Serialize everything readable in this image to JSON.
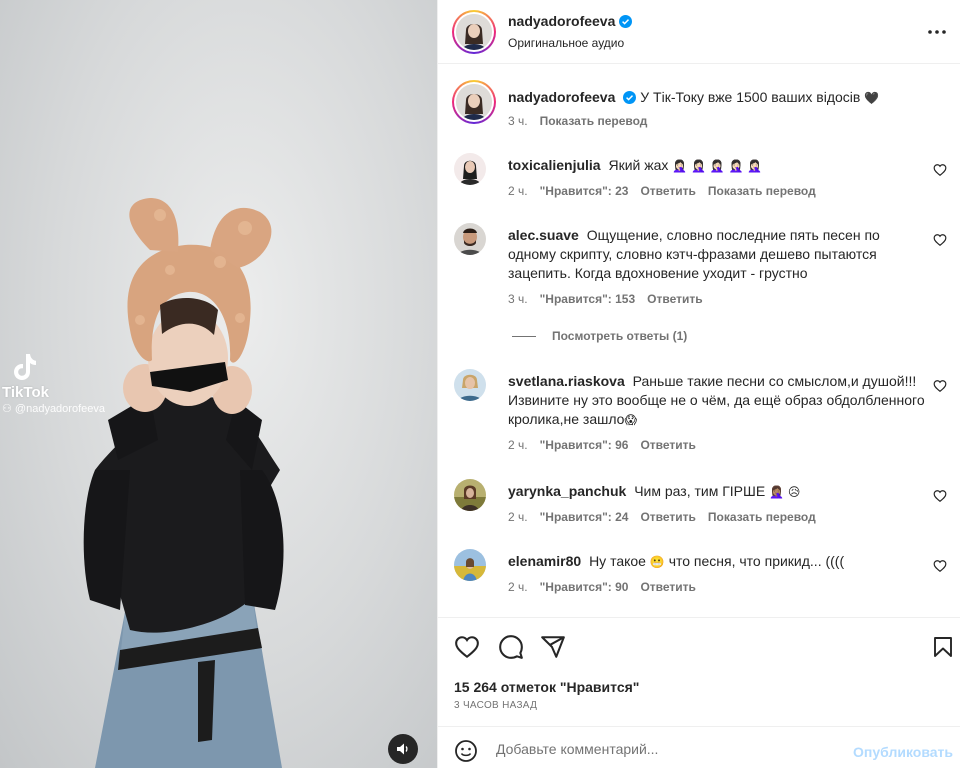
{
  "post": {
    "author": "nadyadorofeeva",
    "audio": "Оригинальное аудио",
    "caption_text": "У Тік-Току вже 1500 ваших відосів",
    "caption_emoji": "🖤",
    "caption_time": "3 ч.",
    "translate_label": "Показать перевод"
  },
  "media": {
    "watermark_brand": "TikTok",
    "watermark_handle": "@nadyadorofeeva"
  },
  "comments": [
    {
      "username": "toxicalienjulia",
      "text": "Який жах",
      "emoji": "🤦🏻‍♀️ 🤦🏻‍♀️ 🤦🏻‍♀️ 🤦🏻‍♀️ 🤦🏻‍♀️",
      "time": "2 ч.",
      "likes": "\"Нравится\": 23",
      "reply": "Ответить",
      "translate": "Показать перевод"
    },
    {
      "username": "alec.suave",
      "text": "Ощущение, словно последние пять песен по одному скрипту, словно кэтч-фразами дешево пытаются зацепить. Когда вдохновение уходит - грустно",
      "time": "3 ч.",
      "likes": "\"Нравится\": 153",
      "reply": "Ответить",
      "view_replies": "Посмотреть ответы (1)"
    },
    {
      "username": "svetlana.riaskova",
      "text": "Раньше такие песни со смыслом,и душой!!! Извините ну это вообще не о чём, да ещё образ обдолбленного кролика,не зашло",
      "emoji": "😱",
      "time": "2 ч.",
      "likes": "\"Нравится\": 96",
      "reply": "Ответить"
    },
    {
      "username": "yarynka_panchuk",
      "text": "Чим раз, тим ГІРШЕ",
      "emoji": "🤦🏽‍♀️ 😥",
      "time": "2 ч.",
      "likes": "\"Нравится\": 24",
      "reply": "Ответить",
      "translate": "Показать перевод"
    },
    {
      "username": "elenamir80",
      "text_before": "Ну такое",
      "emoji": "😬",
      "text_after": "что песня, что прикид... ((((",
      "time": "2 ч.",
      "likes": "\"Нравится\": 90",
      "reply": "Ответить"
    }
  ],
  "actions": {
    "likes_count": "15 264 отметок \"Нравится\"",
    "posted_time": "3 ЧАСОВ НАЗАД"
  },
  "composer": {
    "placeholder": "Добавьте комментарий...",
    "post_label": "Опубликовать"
  },
  "icons": [
    "verified-icon",
    "more-icon",
    "heart-icon",
    "comment-icon",
    "share-icon",
    "bookmark-icon",
    "emoji-icon",
    "sound-icon",
    "tiktok-logo-icon"
  ],
  "colors": {
    "verified": "#0095f6",
    "muted": "#737373",
    "post_disabled": "#b3dbff",
    "text": "#262626"
  }
}
